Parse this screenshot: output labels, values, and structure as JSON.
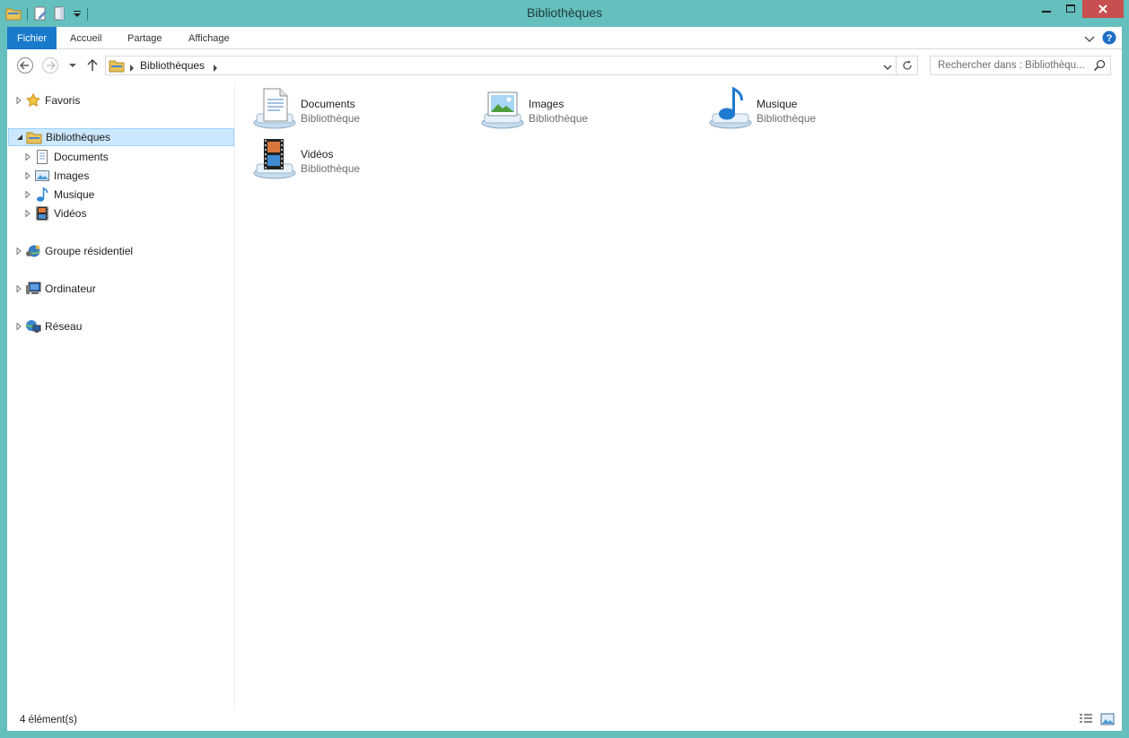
{
  "window": {
    "title": "Bibliothèques",
    "accent": "#64bfbd",
    "close_color": "#c74f4f"
  },
  "ribbon": {
    "tabs": [
      {
        "label": "Fichier"
      },
      {
        "label": "Accueil"
      },
      {
        "label": "Partage"
      },
      {
        "label": "Affichage"
      }
    ]
  },
  "address": {
    "breadcrumb": "Bibliothèques",
    "search_placeholder": "Rechercher dans : Bibliothèqu..."
  },
  "navpane": {
    "items": [
      {
        "label": "Favoris",
        "icon": "star-icon"
      },
      {
        "label": "Bibliothèques",
        "icon": "libraries-icon",
        "selected": true
      },
      {
        "label": "Documents",
        "icon": "documents-icon"
      },
      {
        "label": "Images",
        "icon": "images-icon"
      },
      {
        "label": "Musique",
        "icon": "music-icon"
      },
      {
        "label": "Vidéos",
        "icon": "videos-icon"
      },
      {
        "label": "Groupe résidentiel",
        "icon": "homegroup-icon"
      },
      {
        "label": "Ordinateur",
        "icon": "computer-icon"
      },
      {
        "label": "Réseau",
        "icon": "network-icon"
      }
    ]
  },
  "libraries": [
    {
      "name": "Documents",
      "type": "Bibliothèque",
      "icon": "documents-library-icon"
    },
    {
      "name": "Images",
      "type": "Bibliothèque",
      "icon": "images-library-icon"
    },
    {
      "name": "Musique",
      "type": "Bibliothèque",
      "icon": "music-library-icon"
    },
    {
      "name": "Vidéos",
      "type": "Bibliothèque",
      "icon": "videos-library-icon"
    }
  ],
  "status": {
    "count": "4 élément(s)"
  }
}
